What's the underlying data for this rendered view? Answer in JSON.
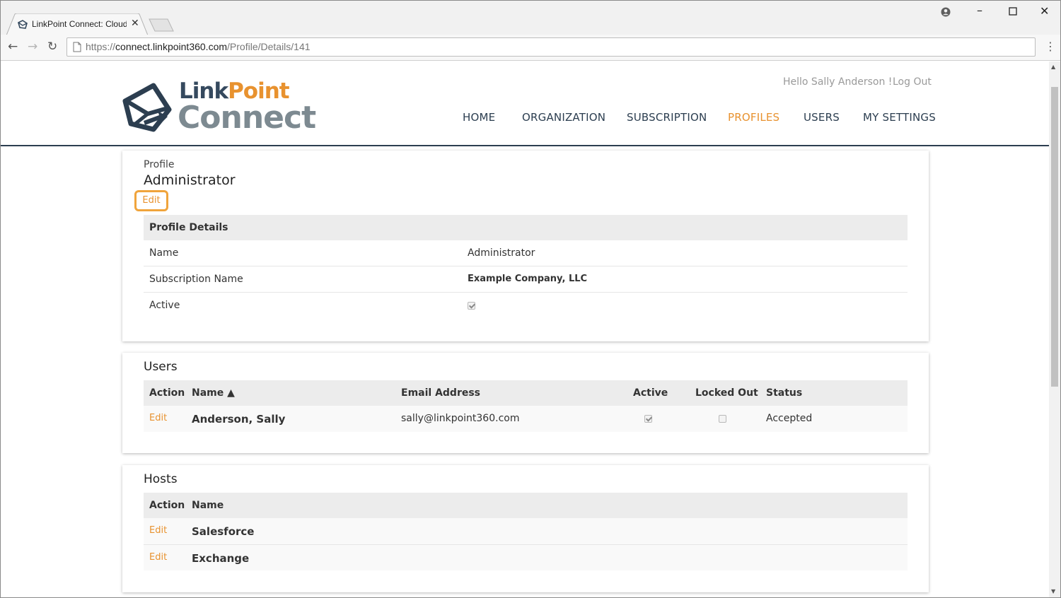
{
  "browser": {
    "tab_title": "LinkPoint Connect: Cloud",
    "url_scheme": "https://",
    "url_host": "connect.linkpoint360.com",
    "url_path": "/Profile/Details/141"
  },
  "header": {
    "logo_word1_a": "Link",
    "logo_word1_b": "Point",
    "logo_word2": "Connect",
    "greeting": "Hello Sally Anderson !",
    "logout": "Log Out",
    "nav": [
      "HOME",
      "ORGANIZATION",
      "SUBSCRIPTION",
      "PROFILES",
      "USERS",
      "MY SETTINGS"
    ],
    "active_nav": "PROFILES"
  },
  "profile": {
    "label": "Profile",
    "name": "Administrator",
    "edit": "Edit",
    "details_header": "Profile Details",
    "rows": [
      {
        "label": "Name",
        "value": "Administrator"
      },
      {
        "label": "Subscription Name",
        "value": "Example Company, LLC"
      },
      {
        "label": "Active",
        "checked": true
      }
    ]
  },
  "users": {
    "title": "Users",
    "columns": [
      "Action",
      "Name ▲",
      "Email Address",
      "Active",
      "Locked Out",
      "Status"
    ],
    "rows": [
      {
        "action": "Edit",
        "name": "Anderson, Sally",
        "email": "sally@linkpoint360.com",
        "active": true,
        "locked_out": false,
        "status": "Accepted"
      }
    ]
  },
  "hosts": {
    "title": "Hosts",
    "columns": [
      "Action",
      "Name"
    ],
    "rows": [
      {
        "action": "Edit",
        "name": "Salesforce"
      },
      {
        "action": "Edit",
        "name": "Exchange"
      }
    ]
  },
  "colors": {
    "accent": "#e8922f",
    "navy": "#2c3e50",
    "gray_logo": "#7d8a91"
  }
}
